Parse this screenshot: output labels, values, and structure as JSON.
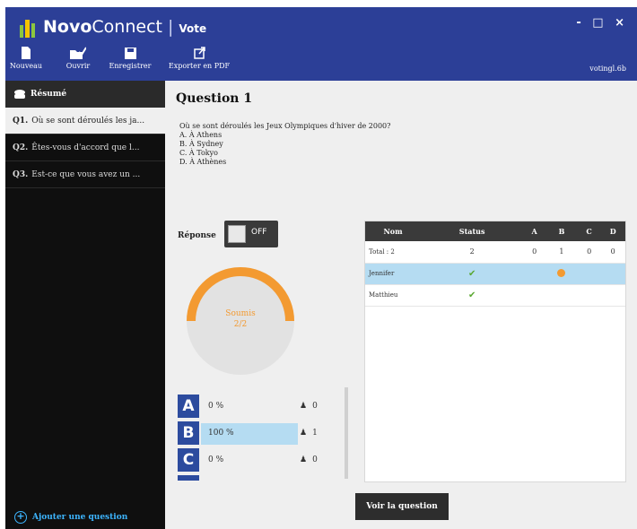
{
  "app": {
    "name_bold": "Novo",
    "name_thin": "Connect",
    "separator": "|",
    "mode": "Vote",
    "window_controls": "- □ ×"
  },
  "toolbar": {
    "items": [
      {
        "label": "Nouveau",
        "icon": "new-document-icon"
      },
      {
        "label": "Ouvrir",
        "icon": "open-folder-icon"
      },
      {
        "label": "Enregistrer",
        "icon": "save-icon"
      },
      {
        "label": "Exporter en PDF",
        "icon": "export-icon"
      }
    ],
    "user": "votingl.6b"
  },
  "sidebar": {
    "header": "Résumé",
    "items": [
      {
        "num": "Q1.",
        "text": "Où se sont déroulés les ja..."
      },
      {
        "num": "Q2.",
        "text": "Êtes-vous d'accord que l..."
      },
      {
        "num": "Q3.",
        "text": "Est-ce que vous avez un ..."
      }
    ],
    "add_label": "Ajouter une question"
  },
  "question": {
    "title": "Question 1",
    "text": "Où se sont déroulés les Jeux Olympiques d'hiver de 2000?",
    "options": [
      "A. À Athens",
      "B. À Sydney",
      "C. À Tokyo",
      "D. À Athènes"
    ]
  },
  "response": {
    "label": "Réponse",
    "toggle": "OFF"
  },
  "gauge": {
    "line1": "Soumis",
    "line2": "2/2",
    "fraction": 1.0
  },
  "answers": [
    {
      "letter": "A",
      "pct": "0 %",
      "count": "0"
    },
    {
      "letter": "B",
      "pct": "100   %",
      "count": "1"
    },
    {
      "letter": "C",
      "pct": "0 %",
      "count": "0"
    }
  ],
  "table": {
    "headers": [
      "Nom",
      "Status",
      "A",
      "B",
      "C",
      "D"
    ],
    "total": [
      "Total : 2",
      "2",
      "0",
      "1",
      "0",
      "0"
    ],
    "rows": [
      {
        "name": "Jennifer",
        "selected": true
      },
      {
        "name": "Matthieu",
        "selected": false
      }
    ]
  },
  "view_button": "Voir la question",
  "colors": {
    "brand_blue": "#2c3f97",
    "answer_blue": "#2c4b9e",
    "orange": "#f39a31",
    "highlight": "#b5dcf2",
    "link": "#3db5ff"
  }
}
